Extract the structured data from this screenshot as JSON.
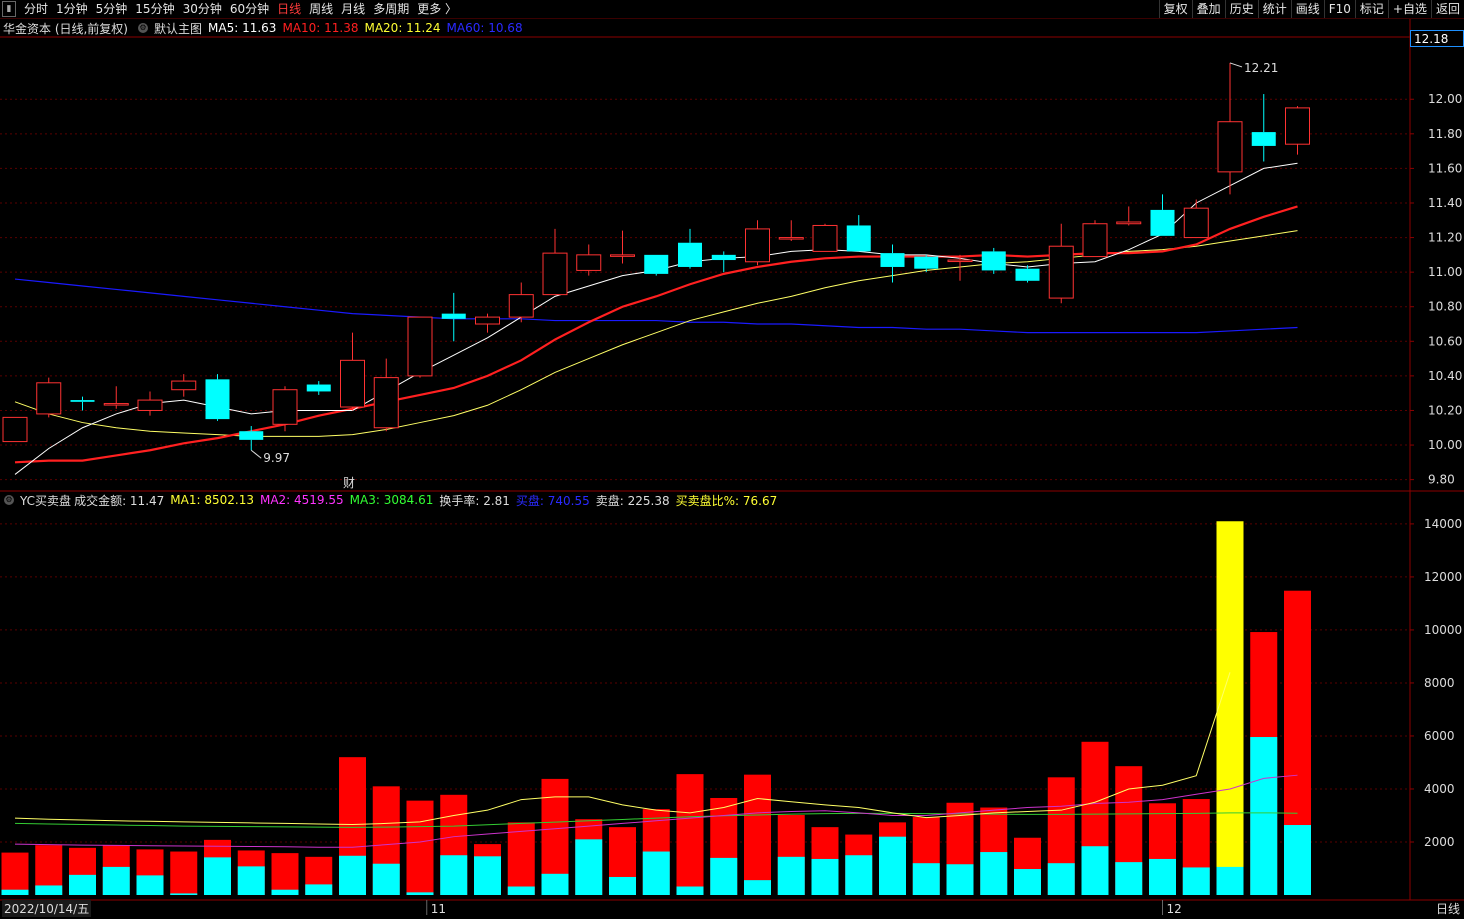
{
  "toolbar": {
    "left_items": [
      "分时",
      "1分钟",
      "5分钟",
      "15分钟",
      "30分钟",
      "60分钟",
      "日线",
      "周线",
      "月线",
      "多周期",
      "更多 〉"
    ],
    "active_item": "日线",
    "right_items": [
      "复权",
      "叠加",
      "历史",
      "统计",
      "画线",
      "F10",
      "标记",
      "+自选",
      "返回"
    ]
  },
  "main_legend": {
    "stock": "华金资本 (日线,前复权)",
    "template": "默认主图",
    "ma5": "MA5: 11.63",
    "ma10": "MA10: 11.38",
    "ma20": "MA20: 11.24",
    "ma60": "MA60: 10.68"
  },
  "sub_legend": {
    "name": "YC买卖盘",
    "amount": "成交金额: 11.47",
    "ma1": "MA1: 8502.13",
    "ma2": "MA2: 4519.55",
    "ma3": "MA3: 3084.61",
    "turnover": "换手率: 2.81",
    "buy": "买盘: 740.55",
    "sell": "卖盘: 225.38",
    "ratio": "买卖盘比%: 76.67"
  },
  "current_price": "12.18",
  "period": "日线",
  "date": "2022/10/14/五",
  "finance_mark": "财",
  "month_labels": [
    "11",
    "12"
  ],
  "colors": {
    "up": "#ff3232",
    "down": "#00ffff",
    "ma5": "#ffffff",
    "ma10": "#ff2020",
    "ma20": "#ffff66",
    "ma60": "#1a1aff",
    "grid": "#5a0000",
    "axis": "#8b0000"
  },
  "chart_data": [
    {
      "type": "candlestick",
      "y_ticks": [
        "12.00",
        "11.80",
        "11.60",
        "11.40",
        "11.20",
        "11.00",
        "10.80",
        "10.60",
        "10.40",
        "10.20",
        "10.00",
        "9.80"
      ],
      "ylim": [
        9.74,
        12.36
      ],
      "high_annotation": "12.21",
      "low_annotation": "9.97",
      "ohlc": [
        [
          10.02,
          10.16,
          10.02,
          10.16
        ],
        [
          10.18,
          10.39,
          10.16,
          10.36
        ],
        [
          10.26,
          10.28,
          10.2,
          10.25
        ],
        [
          10.24,
          10.34,
          10.21,
          10.24
        ],
        [
          10.2,
          10.31,
          10.17,
          10.26
        ],
        [
          10.32,
          10.41,
          10.28,
          10.37
        ],
        [
          10.38,
          10.41,
          10.14,
          10.15
        ],
        [
          10.08,
          10.11,
          9.97,
          10.03
        ],
        [
          10.12,
          10.34,
          10.08,
          10.32
        ],
        [
          10.35,
          10.37,
          10.29,
          10.31
        ],
        [
          10.22,
          10.65,
          10.2,
          10.49
        ],
        [
          10.1,
          10.5,
          10.08,
          10.39
        ],
        [
          10.4,
          10.74,
          10.39,
          10.74
        ],
        [
          10.76,
          10.88,
          10.6,
          10.73
        ],
        [
          10.7,
          10.76,
          10.65,
          10.74
        ],
        [
          10.74,
          10.94,
          10.71,
          10.87
        ],
        [
          10.87,
          11.25,
          10.87,
          11.11
        ],
        [
          11.01,
          11.16,
          10.98,
          11.1
        ],
        [
          11.1,
          11.24,
          11.05,
          11.1
        ],
        [
          11.1,
          11.1,
          10.98,
          10.99
        ],
        [
          11.17,
          11.25,
          11.02,
          11.03
        ],
        [
          11.1,
          11.12,
          11.0,
          11.07
        ],
        [
          11.06,
          11.3,
          11.04,
          11.25
        ],
        [
          11.2,
          11.3,
          11.18,
          11.2
        ],
        [
          11.12,
          11.28,
          11.12,
          11.27
        ],
        [
          11.27,
          11.33,
          11.13,
          11.12
        ],
        [
          11.11,
          11.16,
          10.94,
          11.03
        ],
        [
          11.09,
          11.1,
          11.0,
          11.02
        ],
        [
          11.07,
          11.1,
          10.95,
          11.07
        ],
        [
          11.12,
          11.14,
          10.99,
          11.01
        ],
        [
          11.02,
          11.04,
          10.94,
          10.95
        ],
        [
          10.85,
          11.28,
          10.82,
          11.15
        ],
        [
          11.09,
          11.3,
          11.09,
          11.28
        ],
        [
          11.28,
          11.38,
          11.27,
          11.29
        ],
        [
          11.36,
          11.45,
          11.21,
          11.21
        ],
        [
          11.2,
          11.42,
          11.2,
          11.37
        ],
        [
          11.58,
          12.21,
          11.45,
          11.87
        ],
        [
          11.81,
          12.03,
          11.64,
          11.73
        ],
        [
          11.74,
          11.96,
          11.68,
          11.95
        ]
      ],
      "ma5": [
        9.83,
        9.98,
        10.1,
        10.18,
        10.24,
        10.26,
        10.22,
        10.18,
        10.2,
        10.2,
        10.2,
        10.31,
        10.42,
        10.52,
        10.62,
        10.74,
        10.86,
        10.92,
        10.98,
        11.01,
        11.06,
        11.08,
        11.09,
        11.12,
        11.13,
        11.12,
        11.1,
        11.1,
        11.08,
        11.05,
        11.03,
        11.05,
        11.06,
        11.13,
        11.22,
        11.4,
        11.5,
        11.6,
        11.63
      ],
      "ma10": [
        9.9,
        9.91,
        9.91,
        9.94,
        9.97,
        10.01,
        10.04,
        10.08,
        10.12,
        10.17,
        10.21,
        10.25,
        10.29,
        10.33,
        10.4,
        10.49,
        10.61,
        10.71,
        10.8,
        10.86,
        10.93,
        10.99,
        11.03,
        11.06,
        11.08,
        11.09,
        11.09,
        11.09,
        11.09,
        11.1,
        11.09,
        11.1,
        11.11,
        11.11,
        11.12,
        11.16,
        11.25,
        11.32,
        11.38
      ],
      "ma20": [
        10.25,
        10.18,
        10.13,
        10.1,
        10.08,
        10.07,
        10.06,
        10.05,
        10.05,
        10.05,
        10.06,
        10.09,
        10.13,
        10.17,
        10.23,
        10.32,
        10.42,
        10.5,
        10.58,
        10.65,
        10.72,
        10.77,
        10.82,
        10.86,
        10.91,
        10.95,
        10.98,
        11.01,
        11.03,
        11.05,
        11.06,
        11.08,
        11.1,
        11.12,
        11.13,
        11.15,
        11.18,
        11.21,
        11.24
      ],
      "ma60": [
        10.96,
        10.94,
        10.92,
        10.9,
        10.88,
        10.86,
        10.84,
        10.82,
        10.8,
        10.78,
        10.76,
        10.75,
        10.74,
        10.73,
        10.73,
        10.73,
        10.72,
        10.72,
        10.72,
        10.72,
        10.71,
        10.71,
        10.7,
        10.7,
        10.69,
        10.68,
        10.68,
        10.67,
        10.67,
        10.66,
        10.65,
        10.65,
        10.65,
        10.65,
        10.65,
        10.65,
        10.66,
        10.67,
        10.68
      ]
    },
    {
      "type": "bar",
      "y_ticks": [
        "14000",
        "12000",
        "10000",
        "8000",
        "6000",
        "4000",
        "2000"
      ],
      "ylim": [
        0,
        14600
      ],
      "series": [
        {
          "name": "买盘",
          "values": [
            1600,
            1880,
            1780,
            1880,
            1720,
            1640,
            2080,
            1680,
            1580,
            1440,
            5200,
            4100,
            3560,
            3780,
            1920,
            2740,
            4380,
            2860,
            2560,
            3240,
            4560,
            3660,
            4540,
            3020,
            2560,
            2280,
            2740,
            2940,
            3480,
            3300,
            2160,
            4440,
            5780,
            4860,
            3460,
            3620,
            14100,
            9920,
            11480
          ]
        },
        {
          "name": "卖盘",
          "values": [
            200,
            360,
            760,
            1060,
            740,
            60,
            1420,
            1080,
            200,
            400,
            1480,
            1180,
            100,
            1500,
            1460,
            320,
            800,
            2100,
            680,
            1640,
            320,
            1400,
            560,
            1440,
            1360,
            1500,
            2200,
            1200,
            1160,
            1620,
            980,
            1200,
            1840,
            1240,
            1360,
            1040,
            1060,
            5960,
            2640
          ]
        }
      ],
      "yellow_bar_index": 36,
      "ma1": [
        2900,
        2860,
        2830,
        2800,
        2780,
        2760,
        2740,
        2720,
        2700,
        2680,
        2660,
        2700,
        2760,
        3000,
        3200,
        3600,
        3700,
        3700,
        3400,
        3200,
        3100,
        3300,
        3640,
        3520,
        3400,
        3300,
        3100,
        2920,
        3000,
        3100,
        3150,
        3200,
        3500,
        4000,
        4140,
        4500,
        8400,
        null,
        null
      ],
      "ma2": [
        1920,
        1900,
        1880,
        1870,
        1860,
        1850,
        1840,
        1830,
        1820,
        1800,
        1800,
        1900,
        2000,
        2200,
        2300,
        2400,
        2500,
        2600,
        2700,
        2800,
        2900,
        3000,
        3100,
        3150,
        3180,
        3100,
        3000,
        3000,
        3100,
        3200,
        3300,
        3350,
        3450,
        3500,
        3600,
        3800,
        4000,
        4400,
        4520
      ],
      "ma3": [
        2700,
        2680,
        2660,
        2640,
        2620,
        2600,
        2590,
        2580,
        2570,
        2560,
        2550,
        2560,
        2580,
        2600,
        2650,
        2700,
        2750,
        2800,
        2850,
        2900,
        2950,
        2990,
        3020,
        3050,
        3070,
        3080,
        3080,
        3070,
        3060,
        3050,
        3040,
        3040,
        3050,
        3060,
        3070,
        3080,
        3100,
        3100,
        3085
      ]
    }
  ]
}
